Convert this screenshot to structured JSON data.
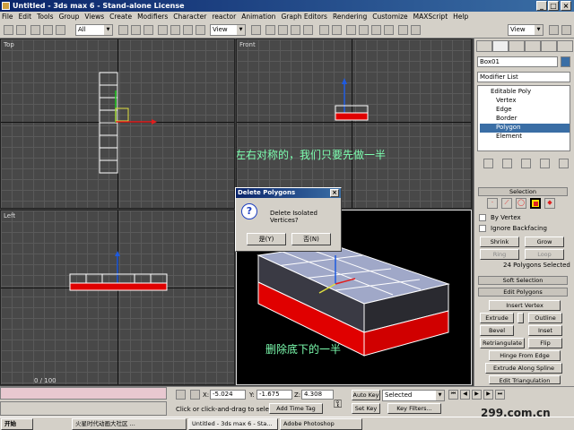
{
  "window": {
    "title": "Untitled - 3ds max 6 - Stand-alone License"
  },
  "menu": [
    "File",
    "Edit",
    "Tools",
    "Group",
    "Views",
    "Create",
    "Modifiers",
    "Character",
    "reactor",
    "Animation",
    "Graph Editors",
    "Rendering",
    "Customize",
    "MAXScript",
    "Help"
  ],
  "toolbar": {
    "selection_filter": "All",
    "ref_coord": "View",
    "ref_coord_right": "View"
  },
  "viewports": {
    "top": "Top",
    "front": "Front",
    "left": "Left",
    "note_top": "因为刀把是左右对称的，我们只要先做一半",
    "note_persp": "删除底下的一半"
  },
  "dialog": {
    "title": "Delete Polygons",
    "message": "Delete Isolated Vertices?",
    "yes": "是(Y)",
    "no": "否(N)",
    "close": "×"
  },
  "panel": {
    "object_name": "Box01",
    "modifier_list": "Modifier List",
    "stack": [
      "Editable Poly",
      "Vertex",
      "Edge",
      "Border",
      "Polygon",
      "Element"
    ],
    "selection_header": "Selection",
    "by_vertex": "By Vertex",
    "ignore_backfacing": "Ignore Backfacing",
    "shrink": "Shrink",
    "grow": "Grow",
    "ring": "Ring",
    "loop": "Loop",
    "selected_info": "24 Polygons Selected",
    "soft_selection": "Soft Selection",
    "edit_polygons": "Edit Polygons",
    "insert_vertex": "Insert Vertex",
    "extrude": "Extrude",
    "outline": "Outline",
    "bevel": "Bevel",
    "inset": "Inset",
    "retriangulate": "Retriangulate",
    "flip": "Flip",
    "hinge": "Hinge From Edge",
    "extrude_spline": "Extrude Along Spline",
    "edit_triangulation": "Edit Triangulation"
  },
  "status": {
    "frame": "0 / 100",
    "x_label": "X:",
    "x": "-5.024",
    "y_label": "Y:",
    "y": "-1.675",
    "z_label": "Z:",
    "z": "4.308",
    "prompt": "Click or click-and-drag to select obj",
    "add_time_tag": "Add Time Tag",
    "auto_key": "Auto Key",
    "set_key": "Set Key",
    "selected": "Selected",
    "key_filters": "Key Filters..."
  },
  "taskbar": {
    "start": "开始",
    "tasks": [
      "火星时代动画大社区 ...",
      "Untitled - 3ds max 6 - Sta...",
      "Adobe Photoshop"
    ],
    "watermark": "299.com.cn"
  }
}
